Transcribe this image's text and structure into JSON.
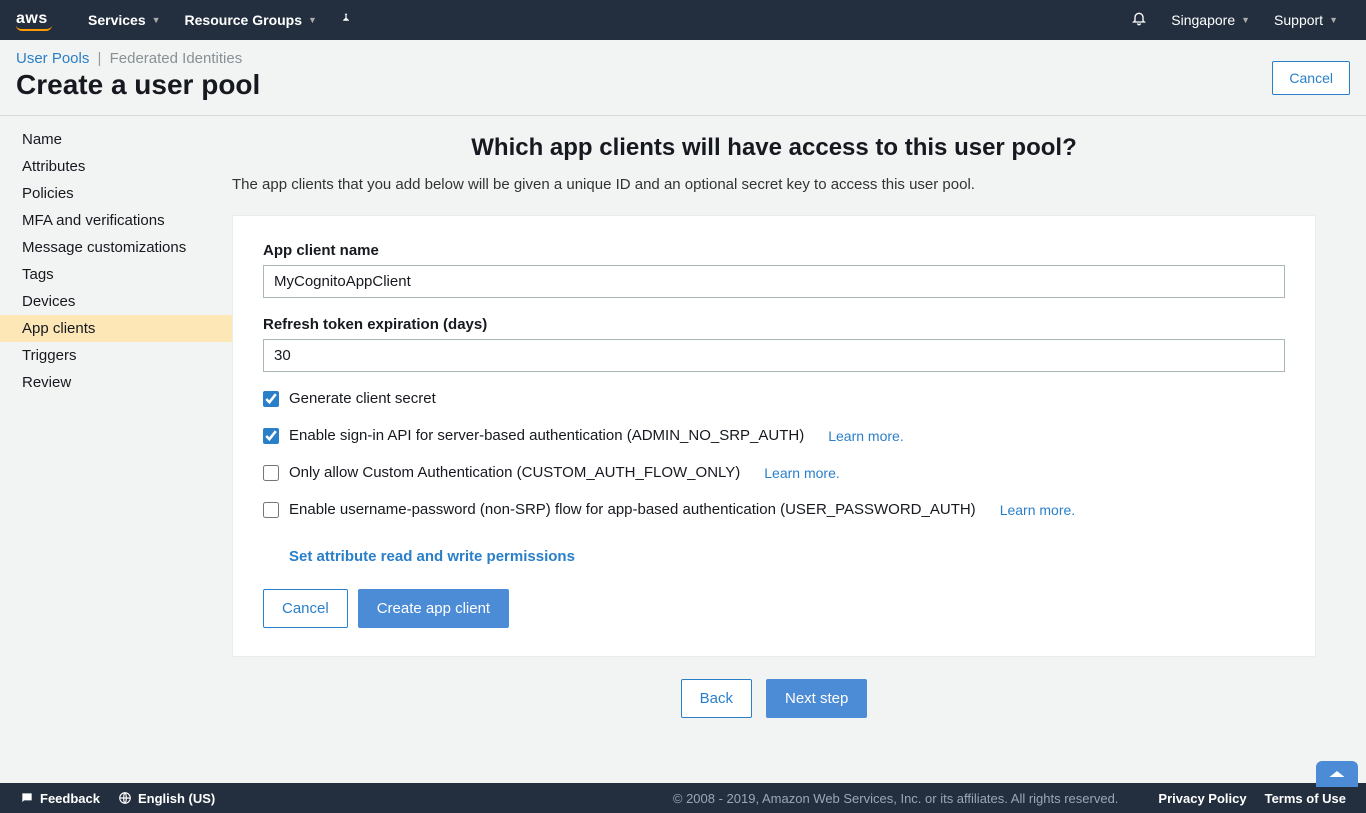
{
  "topnav": {
    "services": "Services",
    "resource_groups": "Resource Groups",
    "region": "Singapore",
    "support": "Support"
  },
  "tabs": {
    "user_pools": "User Pools",
    "federated": "Federated Identities"
  },
  "page_title": "Create a user pool",
  "cancel_top": "Cancel",
  "sidebar": {
    "items": [
      "Name",
      "Attributes",
      "Policies",
      "MFA and verifications",
      "Message customizations",
      "Tags",
      "Devices",
      "App clients",
      "Triggers",
      "Review"
    ],
    "active_index": 7
  },
  "main": {
    "heading": "Which app clients will have access to this user pool?",
    "subtitle": "The app clients that you add below will be given a unique ID and an optional secret key to access this user pool."
  },
  "form": {
    "app_client_label": "App client name",
    "app_client_value": "MyCognitoAppClient",
    "refresh_label": "Refresh token expiration (days)",
    "refresh_value": "30",
    "cb_generate_secret": "Generate client secret",
    "cb_admin_auth": "Enable sign-in API for server-based authentication (ADMIN_NO_SRP_AUTH)",
    "cb_custom_auth": "Only allow Custom Authentication (CUSTOM_AUTH_FLOW_ONLY)",
    "cb_user_password": "Enable username-password (non-SRP) flow for app-based authentication (USER_PASSWORD_AUTH)",
    "learn_more": "Learn more.",
    "perm_link": "Set attribute read and write permissions",
    "cancel": "Cancel",
    "create": "Create app client"
  },
  "nav": {
    "back": "Back",
    "next": "Next step"
  },
  "footer": {
    "feedback": "Feedback",
    "language": "English (US)",
    "copyright": "© 2008 - 2019, Amazon Web Services, Inc. or its affiliates. All rights reserved.",
    "privacy": "Privacy Policy",
    "terms": "Terms of Use"
  }
}
